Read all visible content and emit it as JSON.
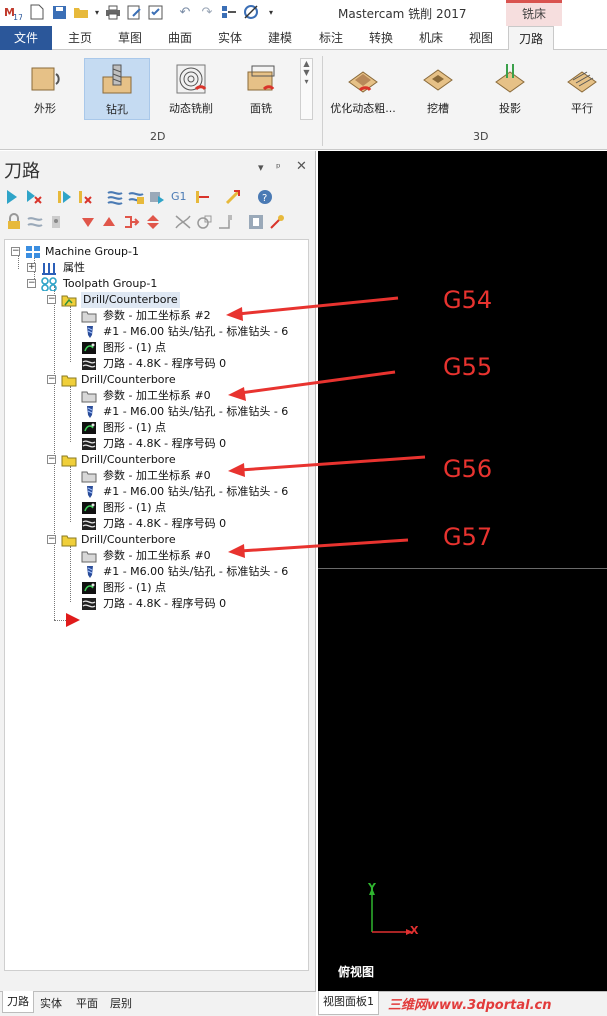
{
  "window": {
    "title": "Mastercam 铣削 2017",
    "context_tab": "铣床"
  },
  "tabs": [
    "文件",
    "主页",
    "草图",
    "曲面",
    "实体",
    "建模",
    "标注",
    "转换",
    "机床",
    "视图",
    "刀路"
  ],
  "active_tab": "刀路",
  "ribbon": {
    "group_2d": "2D",
    "group_3d": "3D",
    "btn_contour": "外形",
    "btn_drill": "钻孔",
    "btn_dynamic": "动态铣削",
    "btn_face": "面铣",
    "btn_opt_rough": "优化动态粗...",
    "btn_pocket": "挖槽",
    "btn_project": "投影",
    "btn_parallel": "平行"
  },
  "panel": {
    "title": "刀路",
    "pin_icon": "pin-icon",
    "close_icon": "close-icon"
  },
  "tree": {
    "machine_group": "Machine Group-1",
    "properties": "属性",
    "toolpath_group": "Toolpath Group-1",
    "ops": [
      {
        "name": "Drill/Counterbore",
        "params": "参数 - 加工坐标系 #2",
        "tool": "#1 - M6.00 钻头/钻孔 - 标准钻头 - 6",
        "geometry": "图形 - (1) 点",
        "toolpath": "刀路 - 4.8K - 程序号码 0"
      },
      {
        "name": "Drill/Counterbore",
        "params": "参数 - 加工坐标系 #0",
        "tool": "#1 - M6.00 钻头/钻孔 - 标准钻头 - 6",
        "geometry": "图形 - (1) 点",
        "toolpath": "刀路 - 4.8K - 程序号码 0"
      },
      {
        "name": "Drill/Counterbore",
        "params": "参数 - 加工坐标系 #0",
        "tool": "#1 - M6.00 钻头/钻孔 - 标准钻头 - 6",
        "geometry": "图形 - (1) 点",
        "toolpath": "刀路 - 4.8K - 程序号码 0"
      },
      {
        "name": "Drill/Counterbore",
        "params": "参数 - 加工坐标系 #0",
        "tool": "#1 - M6.00 钻头/钻孔 - 标准钻头 - 6",
        "geometry": "图形 - (1) 点",
        "toolpath": "刀路 - 4.8K - 程序号码 0"
      }
    ]
  },
  "annotations": [
    "G54",
    "G55",
    "G56",
    "G57"
  ],
  "panel_tabs": [
    "刀路",
    "实体",
    "平面",
    "层别"
  ],
  "viewport": {
    "view_name": "俯视图",
    "axis_x": "X",
    "axis_y": "Y",
    "tab": "视图面板1",
    "watermark": "三维网www.3dportal.cn"
  },
  "colors": {
    "file_tab": "#2b579a",
    "annotation": "#e8332f",
    "axis_x": "#e03030",
    "axis_y": "#2fb52f",
    "viewport_bg": "#000000",
    "selection": "#c5dbf2"
  }
}
